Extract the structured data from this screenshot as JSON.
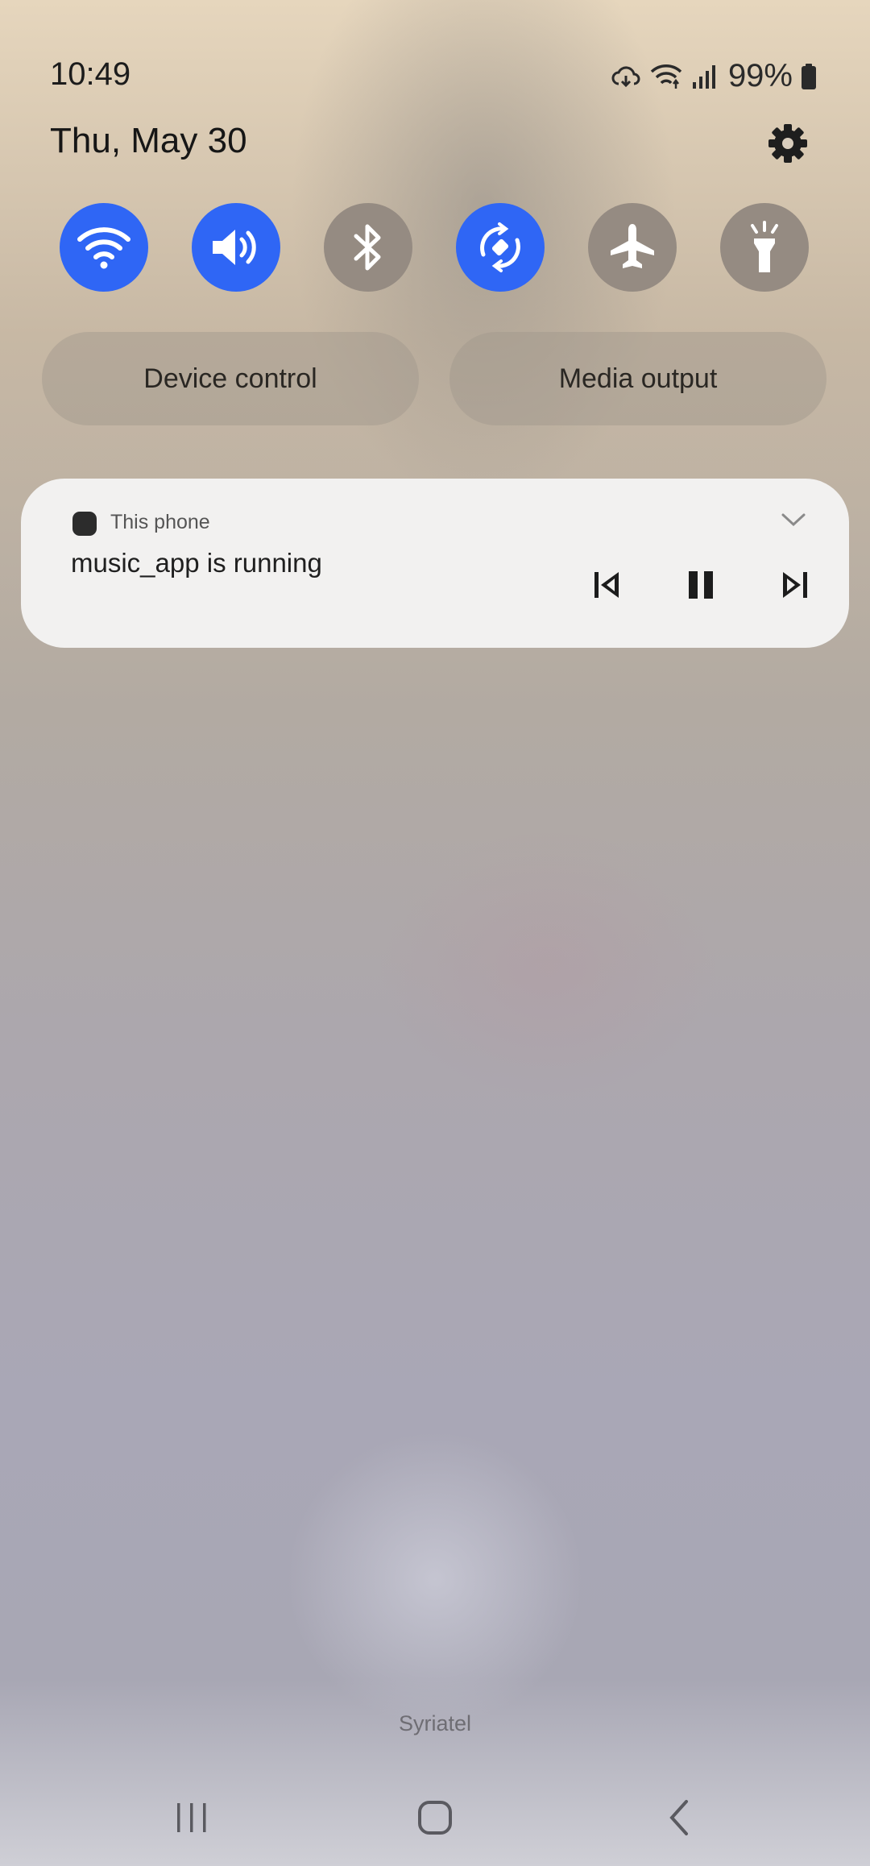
{
  "status_bar": {
    "time": "10:49",
    "battery": "99%",
    "icons": [
      "cloud-sync-icon",
      "wifi-icon",
      "signal-icon",
      "battery-icon"
    ]
  },
  "panel": {
    "date": "Thu, May 30",
    "settings_icon": "gear-icon"
  },
  "quick_settings": [
    {
      "name": "wifi",
      "icon": "wifi-icon",
      "state": "on"
    },
    {
      "name": "sound",
      "icon": "sound-icon",
      "state": "on"
    },
    {
      "name": "bluetooth",
      "icon": "bluetooth-icon",
      "state": "off"
    },
    {
      "name": "auto-rotate",
      "icon": "auto-rotate-icon",
      "state": "on"
    },
    {
      "name": "airplane-mode",
      "icon": "airplane-icon",
      "state": "off"
    },
    {
      "name": "flashlight",
      "icon": "flashlight-icon",
      "state": "off"
    }
  ],
  "buttons": {
    "device_control": "Device control",
    "media_output": "Media output"
  },
  "media_card": {
    "source": "This phone",
    "title": "music_app is running",
    "controls": [
      "previous-icon",
      "pause-icon",
      "next-icon"
    ]
  },
  "carrier": "Syriatel",
  "colors": {
    "accent_on": "#2f66f5",
    "toggle_off": "#958b82",
    "card_bg": "#f2f1f0"
  }
}
